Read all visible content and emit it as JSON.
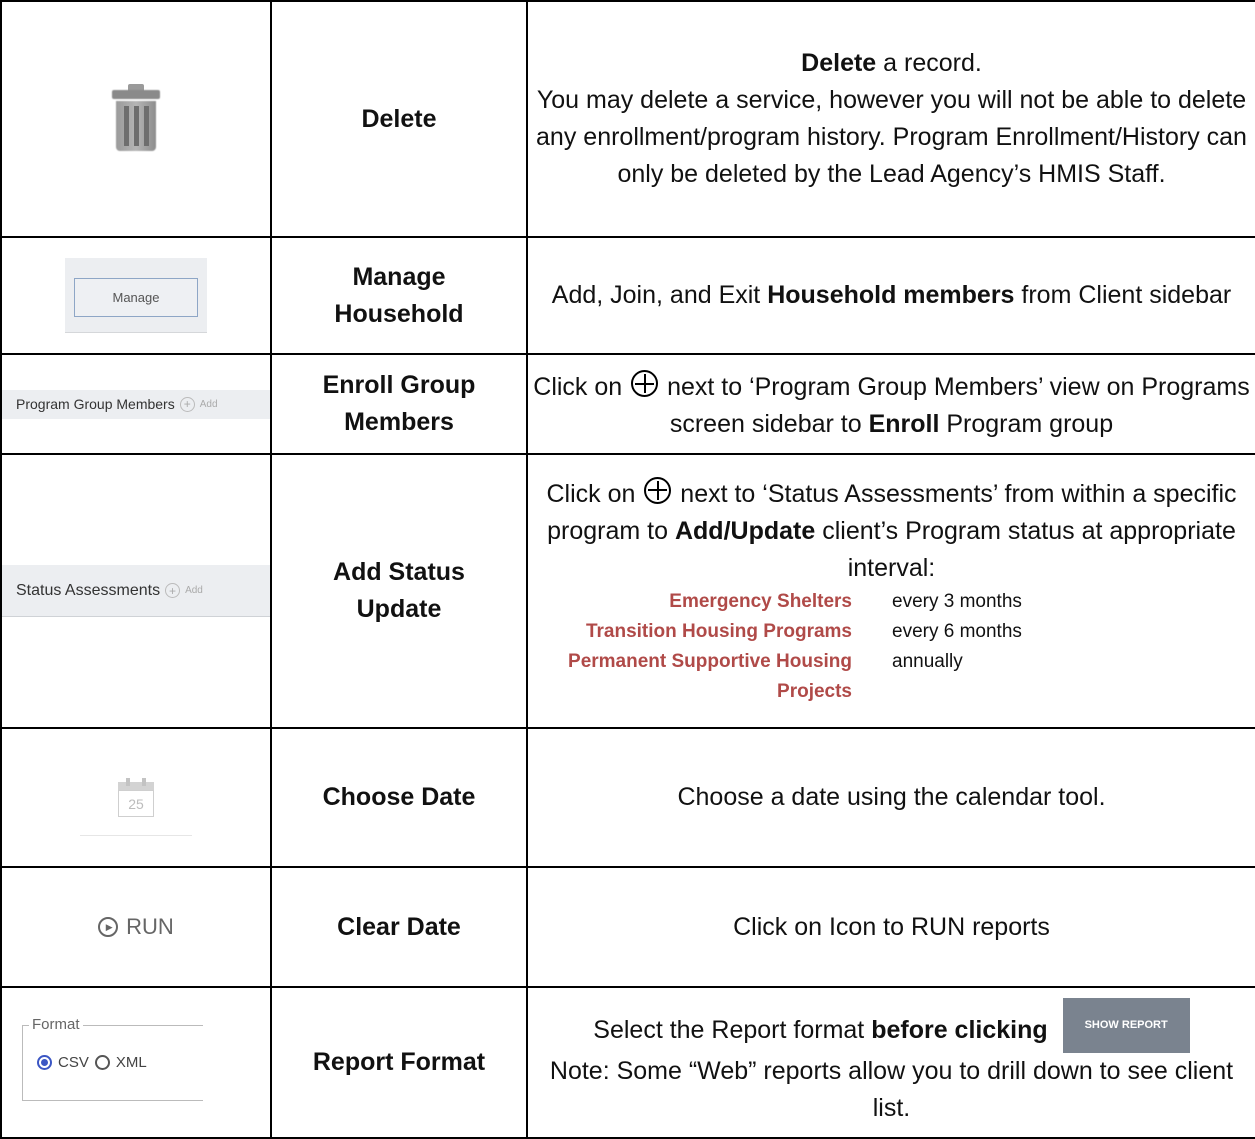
{
  "rows": [
    {
      "name": "Delete",
      "desc_bold": "Delete",
      "desc_rest": " a record.",
      "desc_extra": "You may delete a service, however you will not be able to delete any enrollment/program history. Program Enrollment/History can only be deleted by the Lead Agency’s HMIS Staff."
    },
    {
      "name_line1": "Manage",
      "name_line2": "Household",
      "button_label": "Manage",
      "desc_pre": "Add, Join, and Exit ",
      "desc_bold": "Household members",
      "desc_post": " from Client sidebar"
    },
    {
      "name_line1": "Enroll Group",
      "name_line2": "Members",
      "sidebar_label": "Program Group Members",
      "sidebar_add": "Add",
      "desc_pre": "Click on",
      "desc_mid": " next to ‘Program Group Members’ view on Programs screen sidebar to ",
      "desc_bold": "Enroll",
      "desc_post": " Program group"
    },
    {
      "name_line1": "Add Status",
      "name_line2": "Update",
      "sidebar_label": "Status Assessments",
      "sidebar_add": "Add",
      "desc_pre": "Click on",
      "desc_mid": " next to ‘Status Assessments’ from within a specific program to ",
      "desc_bold": "Add/Update",
      "desc_post": " client’s Program status at appropriate interval:",
      "intervals": [
        {
          "program": "Emergency Shelters",
          "frequency": "every 3 months"
        },
        {
          "program": "Transition Housing Programs",
          "frequency": "every 6 months"
        },
        {
          "program": "Permanent Supportive Housing Projects",
          "frequency": "annually"
        }
      ]
    },
    {
      "name": "Choose Date",
      "calendar_day": "25",
      "desc": "Choose a date using the calendar tool."
    },
    {
      "name": "Clear Date",
      "run_label": "RUN",
      "desc": "Click on Icon to RUN reports"
    },
    {
      "name": "Report Format",
      "format_legend": "Format",
      "option_csv": "CSV",
      "option_xml": "XML",
      "desc_pre": "Select the Report format ",
      "desc_bold": "before clicking",
      "show_report_label": "SHOW REPORT",
      "desc_note": "Note: Some “Web” reports allow you to drill down to see client list."
    }
  ],
  "colors": {
    "program_red": "#b04a48",
    "radio_blue": "#3b56c4",
    "show_report_bg": "#7a838f"
  }
}
